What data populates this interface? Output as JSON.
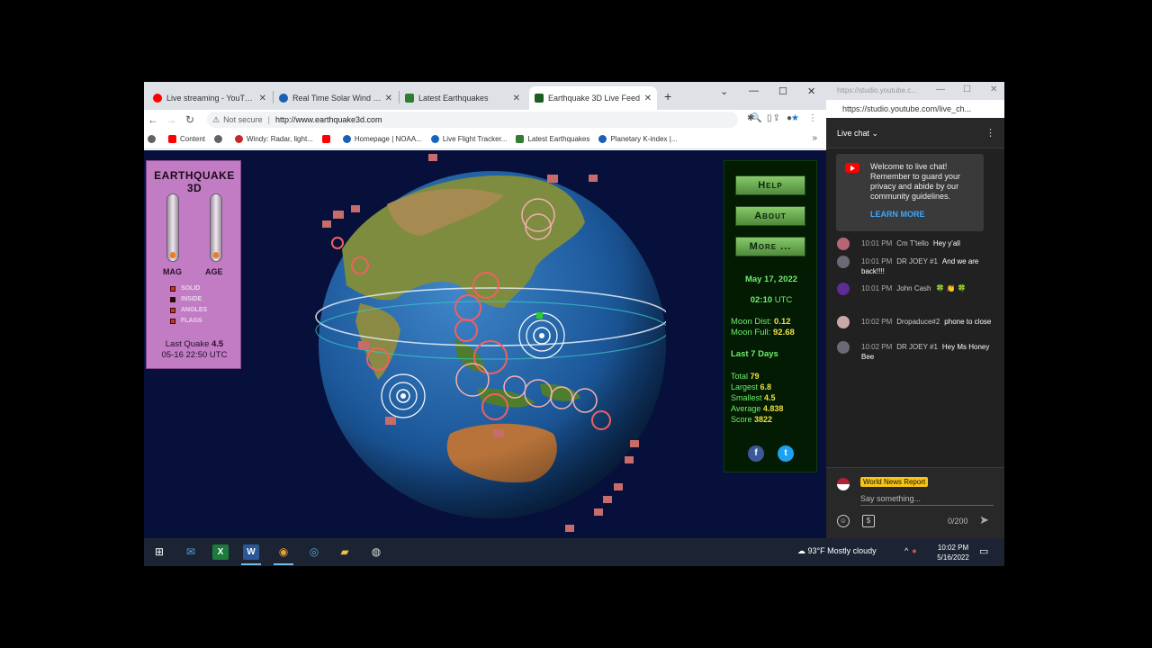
{
  "browser": {
    "tabs": [
      {
        "title": "Live streaming - YouTube",
        "favicon_color": "#ff0000",
        "active": false
      },
      {
        "title": "Real Time Solar Wind | NOAA",
        "favicon_color": "#1a5fb4",
        "active": false
      },
      {
        "title": "Latest Earthquakes",
        "favicon_color": "#2e7d32",
        "active": false
      },
      {
        "title": "Earthquake 3D Live Feed",
        "favicon_color": "#1b5e20",
        "active": true
      }
    ],
    "new_tab_label": "+",
    "window_controls": {
      "menu": "⌄",
      "minimize": "—",
      "maximize": "☐",
      "close": "✕"
    },
    "nav": {
      "back": "←",
      "forward": "→",
      "reload": "↻"
    },
    "address": {
      "security_label": "Not secure",
      "url": "http://www.earthquake3d.com"
    },
    "bookmarks": [
      {
        "label": "",
        "color": "#5f6368"
      },
      {
        "label": "Content",
        "color": "#ff0000"
      },
      {
        "label": "",
        "color": "#5f6368"
      },
      {
        "label": "Windy: Radar, light...",
        "color": "#c62828"
      },
      {
        "label": "",
        "color": "#ff0000"
      },
      {
        "label": "Homepage | NOAA...",
        "color": "#1a5fb4"
      },
      {
        "label": "Live Flight Tracker...",
        "color": "#1565c0"
      },
      {
        "label": "Latest Earthquakes",
        "color": "#2e7d32"
      },
      {
        "label": "Planetary K-index |...",
        "color": "#1a5fb4"
      }
    ],
    "bookmarks_more": "»"
  },
  "earthquake": {
    "title": "EARTHQUAKE 3D",
    "gauges": [
      {
        "label": "MAG",
        "level": 0.1
      },
      {
        "label": "AGE",
        "level": 0.1
      }
    ],
    "legend": [
      {
        "label": "SOLID",
        "color": "#c0392b"
      },
      {
        "label": "INSIDE",
        "color": "#111111"
      },
      {
        "label": "ANGLES",
        "color": "#c0392b"
      },
      {
        "label": "FLAGS",
        "color": "#c0392b"
      }
    ],
    "last_quake_label": "Last Quake",
    "last_quake_mag": "4.5",
    "last_quake_time": "05-16 22:50 UTC"
  },
  "side": {
    "buttons": [
      "Help",
      "About",
      "More ..."
    ],
    "date": "May 17, 2022",
    "time": "02:10",
    "time_zone": "UTC",
    "moon_dist_label": "Moon Dist:",
    "moon_dist": "0.12",
    "moon_full_label": "Moon Full:",
    "moon_full": "92.68",
    "period": "Last 7 Days",
    "stats": [
      {
        "label": "Total",
        "value": "79"
      },
      {
        "label": "Largest",
        "value": "6.8"
      },
      {
        "label": "Smallest",
        "value": "4.5"
      },
      {
        "label": "Average",
        "value": "4.838"
      },
      {
        "label": "Score",
        "value": "3822"
      }
    ],
    "social": {
      "facebook": "f",
      "twitter": "t"
    }
  },
  "chat": {
    "window_title": "https://studio.youtube.c...",
    "url": "https://studio.youtube.com/live_ch...",
    "header": "Live chat",
    "welcome_text": "Welcome to live chat! Remember to guard your privacy and abide by our community guidelines.",
    "learn_more": "LEARN MORE",
    "messages": [
      {
        "time": "10:01 PM",
        "author": "Cm T'tello",
        "text": "Hey y'all",
        "avatar": "#b56576"
      },
      {
        "time": "10:01 PM",
        "author": "DR JOEY #1",
        "text": "And we are back!!!!",
        "avatar": "#6d6875"
      },
      {
        "time": "10:01 PM",
        "author": "John Cash",
        "text": "🍀 👏 🍀",
        "avatar": "#5e2b97"
      },
      {
        "time": "10:02 PM",
        "author": "Dropaduce#2",
        "text": "phone to close",
        "avatar": "#c9a9a6"
      },
      {
        "time": "10:02 PM",
        "author": "DR JOEY #1",
        "text": "Hey Ms Honey Bee",
        "avatar": "#6d6875"
      }
    ],
    "user_name": "World News Report",
    "placeholder": "Say something...",
    "counter": "0/200"
  },
  "taskbar": {
    "weather": "93°F  Mostly cloudy",
    "time": "10:02 PM",
    "date": "5/16/2022"
  }
}
